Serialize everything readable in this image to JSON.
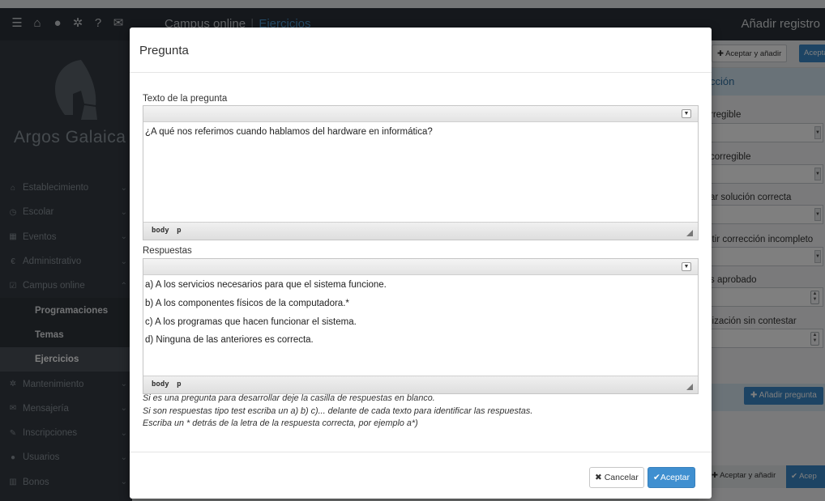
{
  "topbar": {
    "app_title": "Campus online",
    "separator": "|",
    "current_section": "Ejercicios",
    "right_title": "Añadir registro"
  },
  "sidebar": {
    "brand": "Argos Galaica",
    "items": [
      {
        "label": "Establecimiento",
        "icon": "home-icon"
      },
      {
        "label": "Escolar",
        "icon": "clock-icon"
      },
      {
        "label": "Eventos",
        "icon": "calendar-icon"
      },
      {
        "label": "Administrativo",
        "icon": "euro-icon"
      },
      {
        "label": "Campus online",
        "icon": "checkbox-icon"
      },
      {
        "label": "Programaciones",
        "sub": true
      },
      {
        "label": "Temas",
        "sub": true
      },
      {
        "label": "Ejercicios",
        "sub": true,
        "active": true
      },
      {
        "label": "Mantenimiento",
        "icon": "gear-icon"
      },
      {
        "label": "Mensajería",
        "icon": "mail-icon"
      },
      {
        "label": "Inscripciones",
        "icon": "pencil-icon"
      },
      {
        "label": "Usuarios",
        "icon": "user-icon"
      },
      {
        "label": "Bonos",
        "icon": "barcode-icon"
      }
    ]
  },
  "right_panel": {
    "accept_add": "Aceptar y añadir",
    "accept": "Aceptar",
    "header": "cción",
    "labels": [
      "rregible",
      "corregible",
      "ar solución correcta",
      "itir corrección incompleto",
      "s aprobado",
      "lización sin contestar"
    ],
    "add_question": "Añadir pregunta",
    "bottom_accept_add": "Aceptar y añadir",
    "bottom_accept": "Acep"
  },
  "modal": {
    "title": "Pregunta",
    "question_label": "Texto de la pregunta",
    "question_text": "¿A qué nos referimos cuando hablamos del hardware en informática?",
    "editor_path": "body p",
    "answers_label": "Respuestas",
    "answers": [
      "a) A los servicios necesarios para que el sistema funcione.",
      "b) A los componentes físicos de la computadora.*",
      "c) A los programas que hacen funcionar el sistema.",
      "d) Ninguna de las anteriores es correcta."
    ],
    "help_lines": [
      "Si es una pregunta para desarrollar deje la casilla de respuestas en blanco.",
      "Si son respuestas tipo test escriba un a) b) c)... delante de cada texto para identificar las respuestas.",
      "Escriba un * detrás de la letra de la respuesta correcta, por ejemplo a*)"
    ],
    "cancel_label": "Cancelar",
    "accept_label": "Aceptar"
  },
  "colors": {
    "accent": "#3f8fd0",
    "topbar": "#2b3138",
    "sidebar": "#353b42",
    "current_section": "#4b97cf"
  }
}
